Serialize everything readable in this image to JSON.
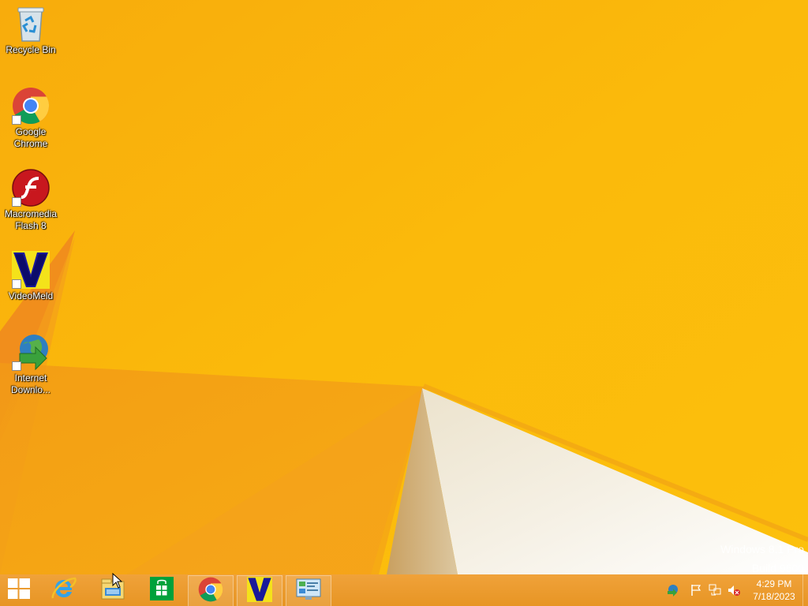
{
  "desktop": {
    "icons": [
      {
        "label_line1": "Recycle Bin",
        "label_line2": "",
        "icon": "recycle-bin-icon"
      },
      {
        "label_line1": "Google",
        "label_line2": "Chrome",
        "icon": "chrome-icon"
      },
      {
        "label_line1": "Macromedia",
        "label_line2": "Flash 8",
        "icon": "flash-icon"
      },
      {
        "label_line1": "VideoMeld",
        "label_line2": "",
        "icon": "videomeld-icon"
      },
      {
        "label_line1": "Internet",
        "label_line2": "Downlo...",
        "icon": "internet-download-manager-icon"
      }
    ],
    "watermark": {
      "line1": "Windows 8.1 Pro",
      "line2": "Build 9600"
    }
  },
  "taskbar": {
    "buttons": [
      {
        "icon": "windows-start-icon",
        "running": false
      },
      {
        "icon": "internet-explorer-icon",
        "running": false
      },
      {
        "icon": "file-explorer-icon",
        "running": false
      },
      {
        "icon": "windows-store-icon",
        "running": false
      },
      {
        "icon": "chrome-icon",
        "running": true
      },
      {
        "icon": "videomeld-icon",
        "running": true
      },
      {
        "icon": "control-panel-icon",
        "running": true
      }
    ],
    "tray_icons": [
      "internet-download-manager-tray-icon",
      "action-center-flag-icon",
      "network-icon",
      "volume-muted-icon"
    ],
    "clock": {
      "time": "4:29 PM",
      "date": "7/18/2023"
    }
  },
  "colors": {
    "wallpaper_primary": "#F9B20B",
    "wallpaper_orange": "#F39A14",
    "taskbar": "#E99527",
    "wallpaper_white": "#F3EEE2"
  }
}
